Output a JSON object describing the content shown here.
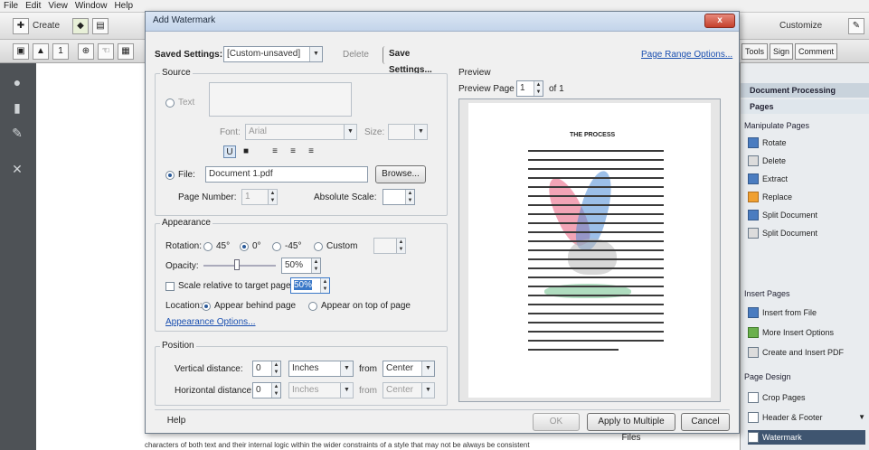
{
  "app": {
    "menu": [
      "File",
      "Edit",
      "View",
      "Window",
      "Help"
    ],
    "toolbar_create": "Create",
    "toolbar_customize": "Customize",
    "tools_btn": "Tools",
    "sign_btn": "Sign",
    "comment_btn": "Comment"
  },
  "right_panel": {
    "section_title": "Document Processing",
    "pages_title": "Pages",
    "manipulate_label": "Manipulate Pages",
    "items": [
      {
        "label": "Rotate",
        "icon": "rotate-icon"
      },
      {
        "label": "Delete",
        "icon": "delete-icon"
      },
      {
        "label": "Extract",
        "icon": "extract-icon"
      },
      {
        "label": "Replace",
        "icon": "replace-icon"
      },
      {
        "label": "Split Document",
        "icon": "split-icon"
      }
    ],
    "insert_label": "Insert Pages",
    "insert_items": [
      {
        "label": "Insert from File",
        "icon": "insert-file-icon"
      },
      {
        "label": "More Insert Options",
        "icon": "insert-options-icon"
      },
      {
        "label": "Create and Insert PDF",
        "icon": "create-pdf-icon"
      }
    ],
    "design_label": "Page Design",
    "design_items": [
      {
        "label": "Crop Pages",
        "icon": "crop-icon"
      },
      {
        "label": "Header & Footer",
        "icon": "header-footer-icon"
      },
      {
        "label": "Watermark",
        "icon": "watermark-icon"
      }
    ]
  },
  "dialog": {
    "title": "Add Watermark",
    "close": "x",
    "saved_settings_label": "Saved Settings:",
    "saved_settings_value": "[Custom-unsaved]",
    "delete_btn": "Delete",
    "save_settings_btn": "Save Settings...",
    "page_range_link": "Page Range Options...",
    "source_label": "Source",
    "text_radio": "Text",
    "font_label": "Font:",
    "font_value": "Arial",
    "size_label": "Size:",
    "file_label": "File:",
    "file_value": "Document 1.pdf",
    "browse_btn": "Browse...",
    "page_number_label": "Page Number:",
    "page_number_value": "1",
    "absolute_scale_label": "Absolute Scale:",
    "appearance_label": "Appearance",
    "rotation_label": "Rotation:",
    "rotation_options": [
      "45°",
      "0°",
      "-45°",
      "Custom"
    ],
    "opacity_label": "Opacity:",
    "opacity_value": "50%",
    "scale_label": "Scale relative to target page:",
    "scale_value": "50%",
    "location_label": "Location:",
    "location_behind": "Appear behind page",
    "location_top": "Appear on top of page",
    "appearance_options_link": "Appearance Options...",
    "position_label": "Position",
    "vertical_label": "Vertical distance:",
    "vertical_value": "0",
    "vertical_from": "Center",
    "vertical_units": "Inches",
    "horizontal_label": "Horizontal distance:",
    "horizontal_value": "0",
    "horizontal_from": "Center",
    "horizontal_units": "Inches",
    "from_label": "from",
    "preview_label": "Preview",
    "preview_page_label": "Preview Page",
    "preview_page_value": "1",
    "preview_page_of": "of 1",
    "help_btn": "Help",
    "ok_btn": "OK",
    "apply_multiple_btn": "Apply to Multiple Files",
    "cancel_btn": "Cancel",
    "preview_title_line": "THE PROCESS"
  },
  "status_text": "characters of both text and their internal logic within the wider constraints of a style that may not be always be consistent"
}
